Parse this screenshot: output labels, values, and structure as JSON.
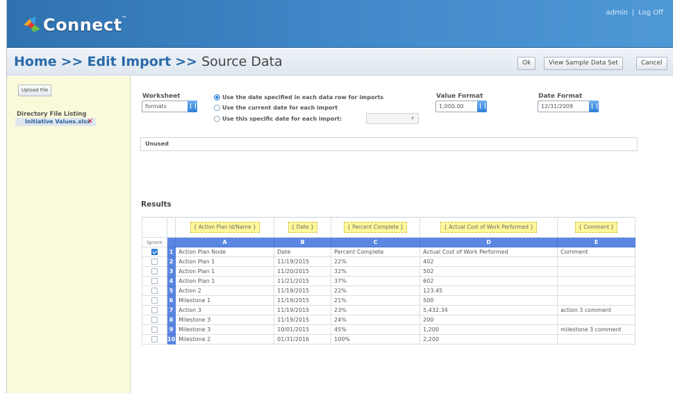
{
  "header": {
    "app_name": "Connect",
    "trademark": "™",
    "user_link": "admin",
    "separator": "|",
    "logout_link": "Log Off"
  },
  "breadcrumb": {
    "home": "Home",
    "sep1": ">>",
    "edit_import": "Edit Import",
    "sep2": ">>",
    "current": "Source Data"
  },
  "toolbar": {
    "ok_label": "Ok",
    "sample_label": "View Sample Data Set",
    "cancel_label": "Cancel"
  },
  "sidebar": {
    "upload_label": "Upload File",
    "directory_title": "Directory File Listing",
    "file_name": "Initiative Values.xlsx",
    "remove_glyph": "✕"
  },
  "settings": {
    "worksheet_label": "Worksheet",
    "worksheet_value": "formats",
    "date_options": [
      {
        "label": "Use the date specified in each data row for imports",
        "selected": true
      },
      {
        "label": "Use the current date for each import",
        "selected": false
      },
      {
        "label": "Use this specific date for each import:",
        "selected": false
      }
    ],
    "value_format_label": "Value Format",
    "value_format_value": "1,000.00",
    "date_format_label": "Date Format",
    "date_format_value": "12/31/2009"
  },
  "unused_label": "Unused",
  "results": {
    "title": "Results",
    "ignore_header": "Ignore",
    "mappings": [
      "{ Action Plan Id/Name }",
      "{ Date }",
      "{ Percent Complete }",
      "{ Actual Cost of Work Performed }",
      "{ Comment }"
    ],
    "columns": [
      "A",
      "B",
      "C",
      "D",
      "E"
    ],
    "rows": [
      {
        "num": "1",
        "ignored": true,
        "cells": [
          "Action Plan Node",
          "Date",
          "Percent Complete",
          "Actual Cost of Work Performed",
          "Comment"
        ]
      },
      {
        "num": "2",
        "ignored": false,
        "cells": [
          "Action Plan 1",
          "11/19/2015",
          "22%",
          "402",
          ""
        ]
      },
      {
        "num": "3",
        "ignored": false,
        "cells": [
          "Action Plan 1",
          "11/20/2015",
          "32%",
          "502",
          ""
        ]
      },
      {
        "num": "4",
        "ignored": false,
        "cells": [
          "Action Plan 1",
          "11/21/2015",
          "37%",
          "602",
          ""
        ]
      },
      {
        "num": "5",
        "ignored": false,
        "cells": [
          "Action 2",
          "11/19/2015",
          "22%",
          "123.45",
          ""
        ]
      },
      {
        "num": "6",
        "ignored": false,
        "cells": [
          "Milestone 1",
          "11/19/2015",
          "21%",
          "500",
          ""
        ]
      },
      {
        "num": "7",
        "ignored": false,
        "cells": [
          "Action 3",
          "11/19/2015",
          "23%",
          "5,432.34",
          "action 3 comment"
        ]
      },
      {
        "num": "8",
        "ignored": false,
        "cells": [
          "Milestone 3",
          "11/19/2015",
          "24%",
          "200",
          ""
        ]
      },
      {
        "num": "9",
        "ignored": false,
        "cells": [
          "Milestone 3",
          "10/01/2015",
          "45%",
          "1,200",
          "milestone 3 comment"
        ]
      },
      {
        "num": "10",
        "ignored": false,
        "cells": [
          "Milestone 2",
          "01/31/2016",
          "100%",
          "2,200",
          ""
        ]
      }
    ]
  },
  "colors": {
    "header_blue": "#3f86c6",
    "column_header_blue": "#5b87e3",
    "mapping_yellow": "#fff79a",
    "sidebar_bg": "#fafadb"
  }
}
